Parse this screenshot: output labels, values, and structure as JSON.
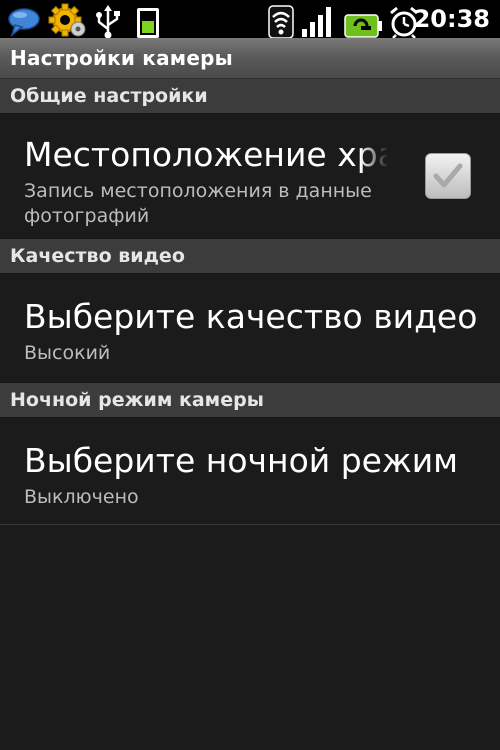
{
  "status_bar": {
    "time": "20:38",
    "icons": [
      "chat-notification-icon",
      "settings-gear-icon",
      "usb-icon",
      "sd-card-icon",
      "wifi-icon",
      "signal-icon",
      "battery-charging-icon",
      "alarm-clock-icon"
    ]
  },
  "title_bar": {
    "title": "Настройки камеры"
  },
  "sections": [
    {
      "header": "Общие настройки",
      "item": {
        "title": "Местоположение хранения",
        "summary": "Запись местоположения в данные фотографий",
        "checked": true
      }
    },
    {
      "header": "Качество видео",
      "item": {
        "title": "Выберите качество видео",
        "summary": "Высокий"
      }
    },
    {
      "header": "Ночной режим камеры",
      "item": {
        "title": "Выберите ночной режим",
        "summary": "Выключено"
      }
    }
  ],
  "colors": {
    "accent_green": "#7ed321",
    "battery_green": "#6fbf1e"
  }
}
